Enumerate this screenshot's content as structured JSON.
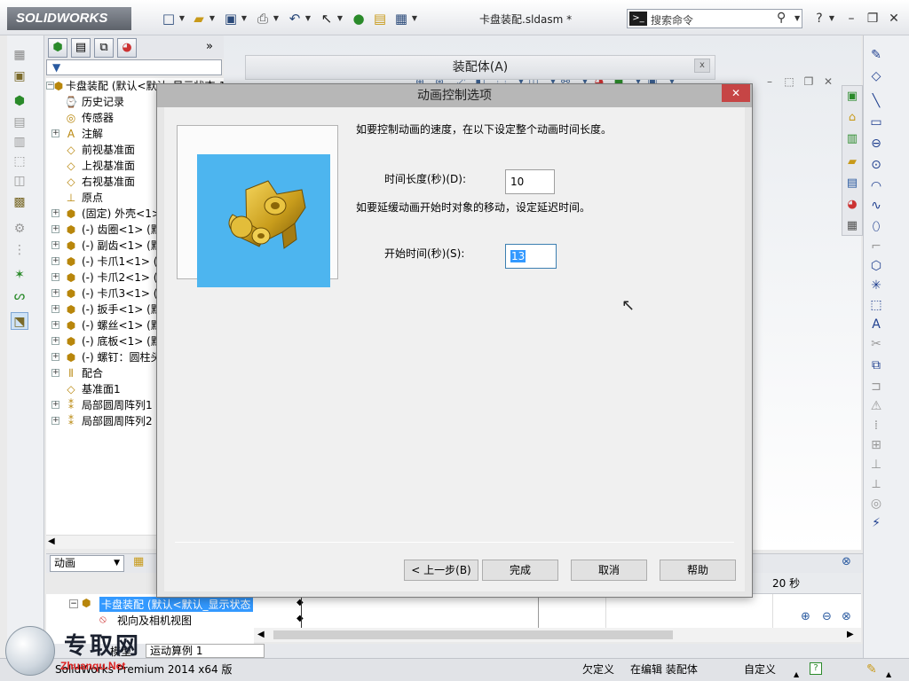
{
  "app": {
    "name": "SOLIDWORKS",
    "document_title": "卡盘装配.sldasm *"
  },
  "search": {
    "placeholder": "搜索命令"
  },
  "feature_tree": {
    "items": [
      {
        "label": "卡盘装配 (默认<默认_显示状态-1>)",
        "expand": "−",
        "icon": "assembly-icon"
      },
      {
        "label": "历史记录",
        "expand": "",
        "icon": "history-icon"
      },
      {
        "label": "传感器",
        "expand": "",
        "icon": "sensor-icon"
      },
      {
        "label": "注解",
        "expand": "+",
        "icon": "annotation-icon"
      },
      {
        "label": "前视基准面",
        "expand": "",
        "icon": "plane-icon"
      },
      {
        "label": "上视基准面",
        "expand": "",
        "icon": "plane-icon"
      },
      {
        "label": "右视基准面",
        "expand": "",
        "icon": "plane-icon"
      },
      {
        "label": "原点",
        "expand": "",
        "icon": "origin-icon"
      },
      {
        "label": "(固定) 外壳<1> (默认",
        "expand": "+",
        "icon": "part-icon"
      },
      {
        "label": "(-) 齿圈<1> (默认",
        "expand": "+",
        "icon": "part-icon"
      },
      {
        "label": "(-) 副齿<1> (默认",
        "expand": "+",
        "icon": "part-icon"
      },
      {
        "label": "(-) 卡爪1<1> (默认",
        "expand": "+",
        "icon": "part-icon"
      },
      {
        "label": "(-) 卡爪2<1> (默认",
        "expand": "+",
        "icon": "part-icon"
      },
      {
        "label": "(-) 卡爪3<1> (默认",
        "expand": "+",
        "icon": "part-icon"
      },
      {
        "label": "(-) 扳手<1> (默认",
        "expand": "+",
        "icon": "part-icon"
      },
      {
        "label": "(-) 螺丝<1> (默认",
        "expand": "+",
        "icon": "part-icon"
      },
      {
        "label": "(-) 底板<1> (默认",
        "expand": "+",
        "icon": "part-icon"
      },
      {
        "label": "(-) 螺钉：圆柱头",
        "expand": "+",
        "icon": "part-icon"
      },
      {
        "label": "配合",
        "expand": "+",
        "icon": "mates-icon"
      },
      {
        "label": "基准面1",
        "expand": "",
        "icon": "plane-icon"
      },
      {
        "label": "局部圆周阵列1",
        "expand": "+",
        "icon": "pattern-icon"
      },
      {
        "label": "局部圆周阵列2",
        "expand": "+",
        "icon": "pattern-icon"
      }
    ]
  },
  "assembly_window": {
    "title": "装配体(A)"
  },
  "motion": {
    "study_type": "动画",
    "time_label": "20 秒",
    "tree": [
      {
        "label": "卡盘装配 (默认<默认_显示状态",
        "expand": "−"
      },
      {
        "label": "视向及相机视图",
        "expand": ""
      }
    ],
    "tab_label": "运动算例 1",
    "tab_left": "模型"
  },
  "dialog": {
    "title": "动画控制选项",
    "instruction1": "如要控制动画的速度，在以下设定整个动画时间长度。",
    "duration_label": "时间长度(秒)(D):",
    "duration_value": "10",
    "instruction2": "如要延缓动画开始时对象的移动，设定延迟时间。",
    "start_label": "开始时间(秒)(S):",
    "start_value": "13",
    "buttons": {
      "back": "< 上一步(B)",
      "finish": "完成",
      "cancel": "取消",
      "help": "帮助"
    },
    "preview_bg": "#4db5ef"
  },
  "status": {
    "left": "SolidWorks Premium 2014 x64 版",
    "undefined": "欠定义",
    "editing": "在编辑 装配体",
    "custom": "自定义",
    "help": "?"
  },
  "watermark": {
    "text": "专取网",
    "url": "Zhuanqu.Net"
  }
}
